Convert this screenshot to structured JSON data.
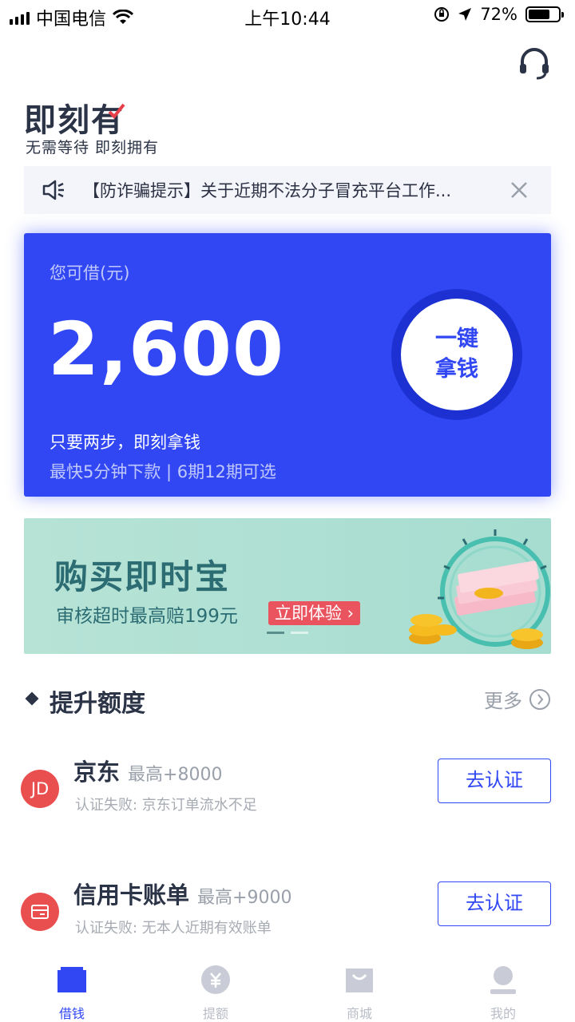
{
  "status_bar": {
    "carrier": "中国电信",
    "time": "上午10:44",
    "battery": "72%",
    "battery_level": 0.72
  },
  "header": {
    "service_icon": "headset-icon",
    "logo_title": "即刻有",
    "slogan": "无需等待  即刻拥有"
  },
  "notice": {
    "icon": "speaker-icon",
    "text": "【防诈骗提示】关于近期不法分子冒充平台工作...",
    "close_icon": "close-icon"
  },
  "loan_card": {
    "label": "您可借(元)",
    "amount": "2,600",
    "sub1": "只要两步，即刻拿钱",
    "sub2": "最快5分钟下款 | 6期12期可选",
    "button_line1": "一键",
    "button_line2": "拿钱",
    "color": "#3047f3"
  },
  "banner": {
    "title": "购买即时宝",
    "subtitle": "审核超时最高赔199元",
    "cta": "立即体验 ›",
    "active_dot": 0,
    "dot_count": 2
  },
  "section": {
    "title": "提升额度",
    "more": "更多"
  },
  "auth_items": [
    {
      "icon_text": "JD",
      "icon": "jd-logo-icon",
      "name": "京东",
      "max": "最高+8000",
      "status": "认证失败: 京东订单流水不足",
      "button": "去认证"
    },
    {
      "icon_text": "",
      "icon": "credit-card-icon",
      "name": "信用卡账单",
      "max": "最高+9000",
      "status": "认证失败: 无本人近期有效账单",
      "button": "去认证"
    }
  ],
  "tabs": [
    {
      "label": "借钱",
      "icon": "wallet-icon",
      "active": true
    },
    {
      "label": "提额",
      "icon": "yuan-coin-icon",
      "active": false
    },
    {
      "label": "商城",
      "icon": "shopping-bag-icon",
      "active": false
    },
    {
      "label": "我的",
      "icon": "user-icon",
      "active": false
    }
  ]
}
